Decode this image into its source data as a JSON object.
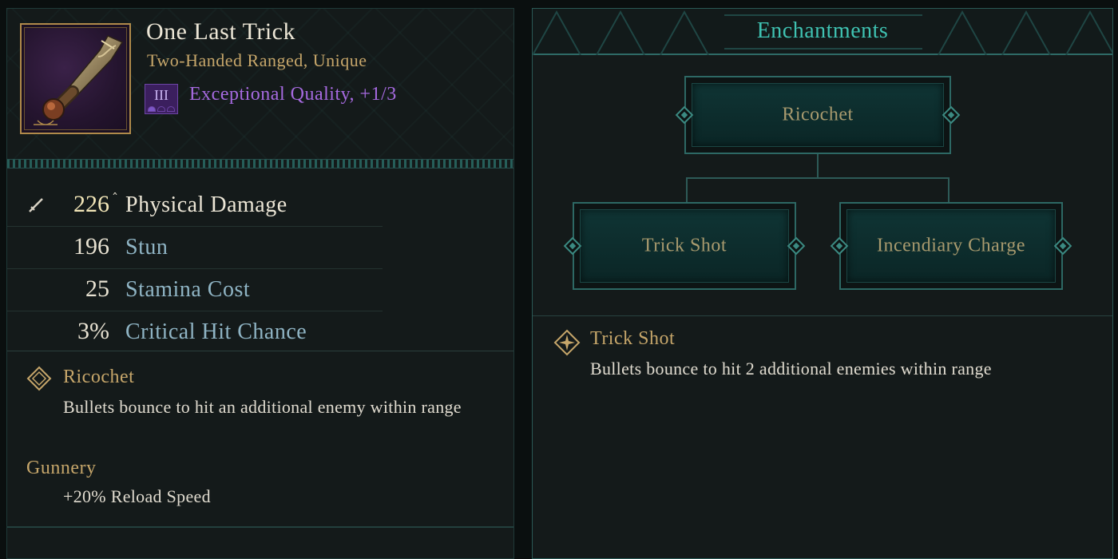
{
  "item": {
    "name": "One Last Trick",
    "type": "Two-Handed Ranged, Unique",
    "quality_badge": "III",
    "quality_text": "Exceptional Quality, +1/3",
    "quality_pips": 3,
    "quality_pips_filled": 1
  },
  "stats": [
    {
      "value": "226",
      "label": "Physical Damage",
      "icon": "sword-icon",
      "arrow": "ˆ"
    },
    {
      "value": "196",
      "label": "Stun"
    },
    {
      "value": "25",
      "label": "Stamina Cost"
    },
    {
      "value": "3%",
      "label": "Critical Hit Chance"
    }
  ],
  "current_enchantment": {
    "icon": "diamond-icon",
    "name": "Ricochet",
    "description": "Bullets bounce to hit an additional enemy within range"
  },
  "skill": {
    "name": "Gunnery",
    "bonus": "+20% Reload Speed"
  },
  "enchant_panel": {
    "title": "Enchantments",
    "tree": {
      "root": "Ricochet",
      "children": [
        "Trick Shot",
        "Incendiary Charge"
      ]
    },
    "selected": {
      "icon": "diamond-icon",
      "name": "Trick Shot",
      "description": "Bullets bounce to hit 2 additional enemies within range"
    }
  },
  "colors": {
    "accent_teal": "#3fc2b2",
    "gold_text": "#c6a66a",
    "quality_purple": "#a66ae0",
    "stat_label_blue": "#8fb4c4"
  }
}
